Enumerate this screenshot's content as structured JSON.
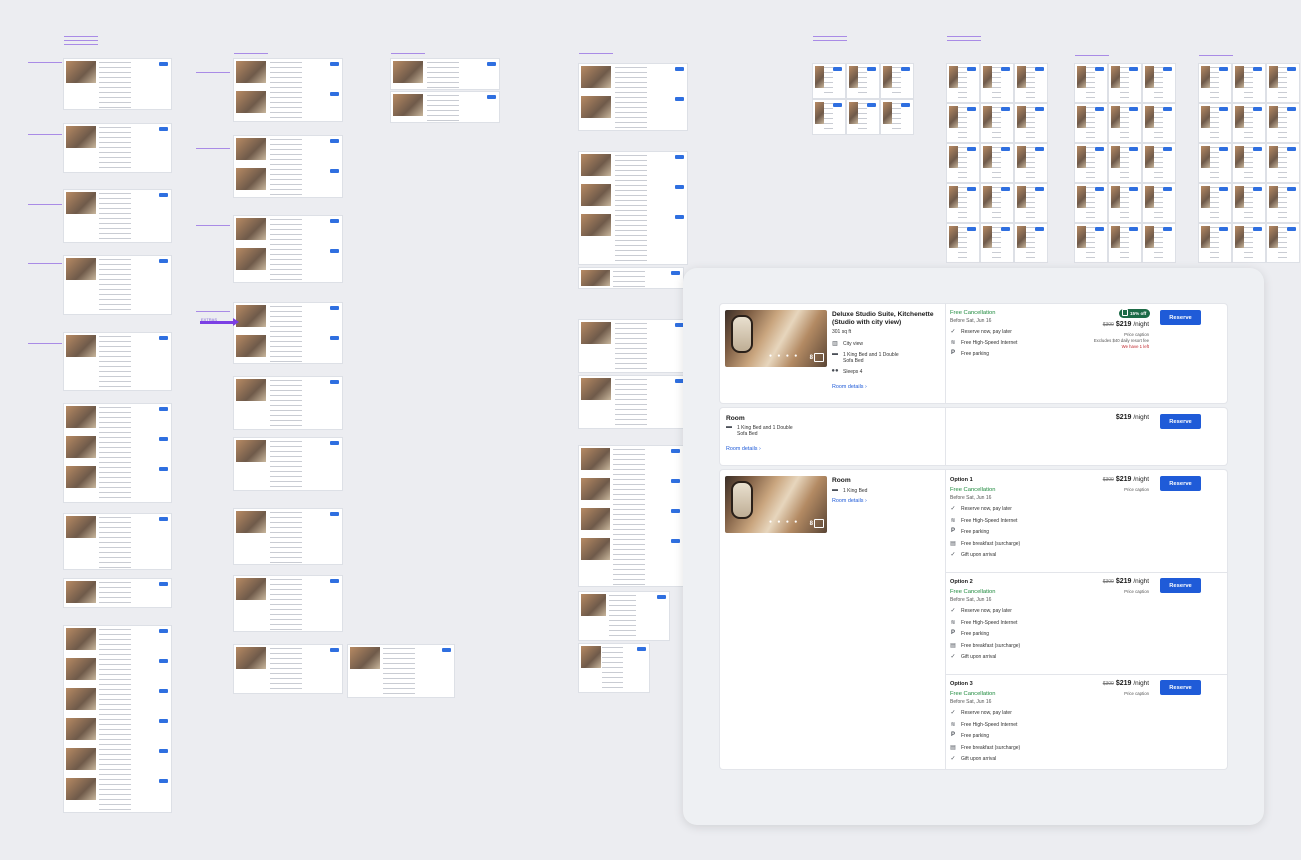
{
  "colors": {
    "accent": "#1f5bd8",
    "free_green": "#1e8a3d",
    "badge_green": "#1d6b47",
    "alert_red": "#c0262c",
    "canvas_bg": "#ecedf1"
  },
  "canvas": {
    "arrow_label": "EXTRAS"
  },
  "room1": {
    "title": "Deluxe Studio Suite, Kitchenette (Studio with city view)",
    "size": "301 sq ft",
    "photo_count": "8",
    "features": [
      {
        "icon": "building-icon",
        "text": "City view"
      },
      {
        "icon": "bed-icon",
        "text": "1 King Bed and 1 Double Sofa Bed"
      },
      {
        "icon": "people-icon",
        "text": "Sleeps 4"
      }
    ],
    "details_link": "Room details",
    "cancel_title": "Free Cancellation",
    "cancel_before": "Before Sat, Jun 16",
    "amenities": [
      {
        "icon": "check-icon",
        "text": "Reserve now, pay later"
      },
      {
        "icon": "wifi-icon",
        "text": "Free High-Speed Internet"
      },
      {
        "icon": "parking-icon",
        "text": "Free parking"
      }
    ],
    "badge": "15% off",
    "old_price": "$300",
    "price": "$219",
    "per": "/night",
    "price_caption": "Price caption",
    "fee_note": "Excludes $40 daily resort fee",
    "left_note": "We have 1 left",
    "reserve": "Reserve"
  },
  "room2": {
    "title": "Room",
    "bed": "1 King Bed and 1 Double Sofa Bed",
    "details_link": "Room details",
    "price": "$219",
    "per": "/night",
    "reserve": "Reserve"
  },
  "room3": {
    "title": "Room",
    "bed": "1 King Bed",
    "details_link": "Room details",
    "photo_count": "8",
    "options": [
      {
        "name": "Option 1",
        "cancel_title": "Free Cancellation",
        "cancel_before": "Before Sat, Jun 16",
        "amenities": [
          "Reserve now, pay later",
          "Free High-Speed Internet",
          "Free parking",
          "Free breakfast (surcharge)",
          "Gift upon arrival"
        ],
        "old_price": "$300",
        "price": "$219",
        "per": "/night",
        "caption": "Price caption",
        "reserve": "Reserve"
      },
      {
        "name": "Option 2",
        "cancel_title": "Free Cancellation",
        "cancel_before": "Before Sat, Jun 16",
        "amenities": [
          "Reserve now, pay later",
          "Free High-Speed Internet",
          "Free parking",
          "Free breakfast (surcharge)",
          "Gift upon arrival"
        ],
        "old_price": "$300",
        "price": "$219",
        "per": "/night",
        "caption": "Price caption",
        "reserve": "Reserve"
      },
      {
        "name": "Option 3",
        "cancel_title": "Free Cancellation",
        "cancel_before": "Before Sat, Jun 16",
        "amenities": [
          "Reserve now, pay later",
          "Free High-Speed Internet",
          "Free parking",
          "Free breakfast (surcharge)",
          "Gift upon arrival"
        ],
        "old_price": "$300",
        "price": "$219",
        "per": "/night",
        "caption": "Price caption",
        "reserve": "Reserve"
      }
    ]
  }
}
